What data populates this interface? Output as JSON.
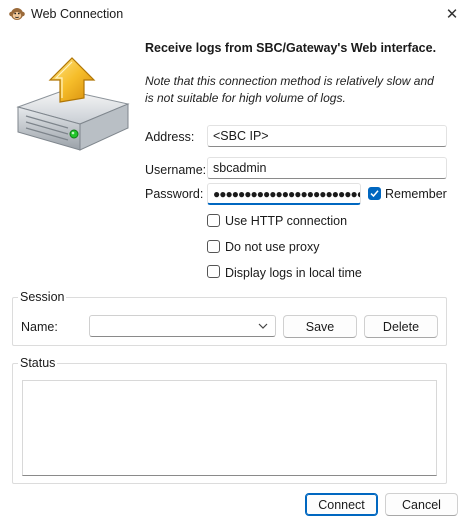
{
  "window": {
    "title": "Web Connection",
    "close_glyph": "✕"
  },
  "heading": "Receive logs from SBC/Gateway's Web interface.",
  "note": "Note that this connection method is relatively slow and is not suitable for high volume of logs.",
  "form": {
    "address_label": "Address:",
    "address_value": "<SBC IP>",
    "username_label": "Username:",
    "username_value": "sbcadmin",
    "password_label": "Password:",
    "password_value": "●●●●●●●●●●●●●●●●●●●●●●●●",
    "remember_label": "Remember",
    "remember_checked": true
  },
  "options": [
    {
      "label": "Use HTTP connection",
      "checked": false
    },
    {
      "label": "Do not use proxy",
      "checked": false
    },
    {
      "label": "Display logs in local time",
      "checked": false
    }
  ],
  "session": {
    "title": "Session",
    "name_label": "Name:",
    "name_value": "",
    "save_label": "Save",
    "delete_label": "Delete"
  },
  "status": {
    "title": "Status",
    "text": ""
  },
  "footer": {
    "connect_label": "Connect",
    "cancel_label": "Cancel"
  },
  "colors": {
    "accent": "#0067c0",
    "arrow": "#f2b118"
  },
  "icons": {
    "app": "monkey-icon",
    "hero": "download-drive-icon",
    "close": "close-icon",
    "combo": "chevron-down-icon",
    "check": "checkmark-icon"
  }
}
